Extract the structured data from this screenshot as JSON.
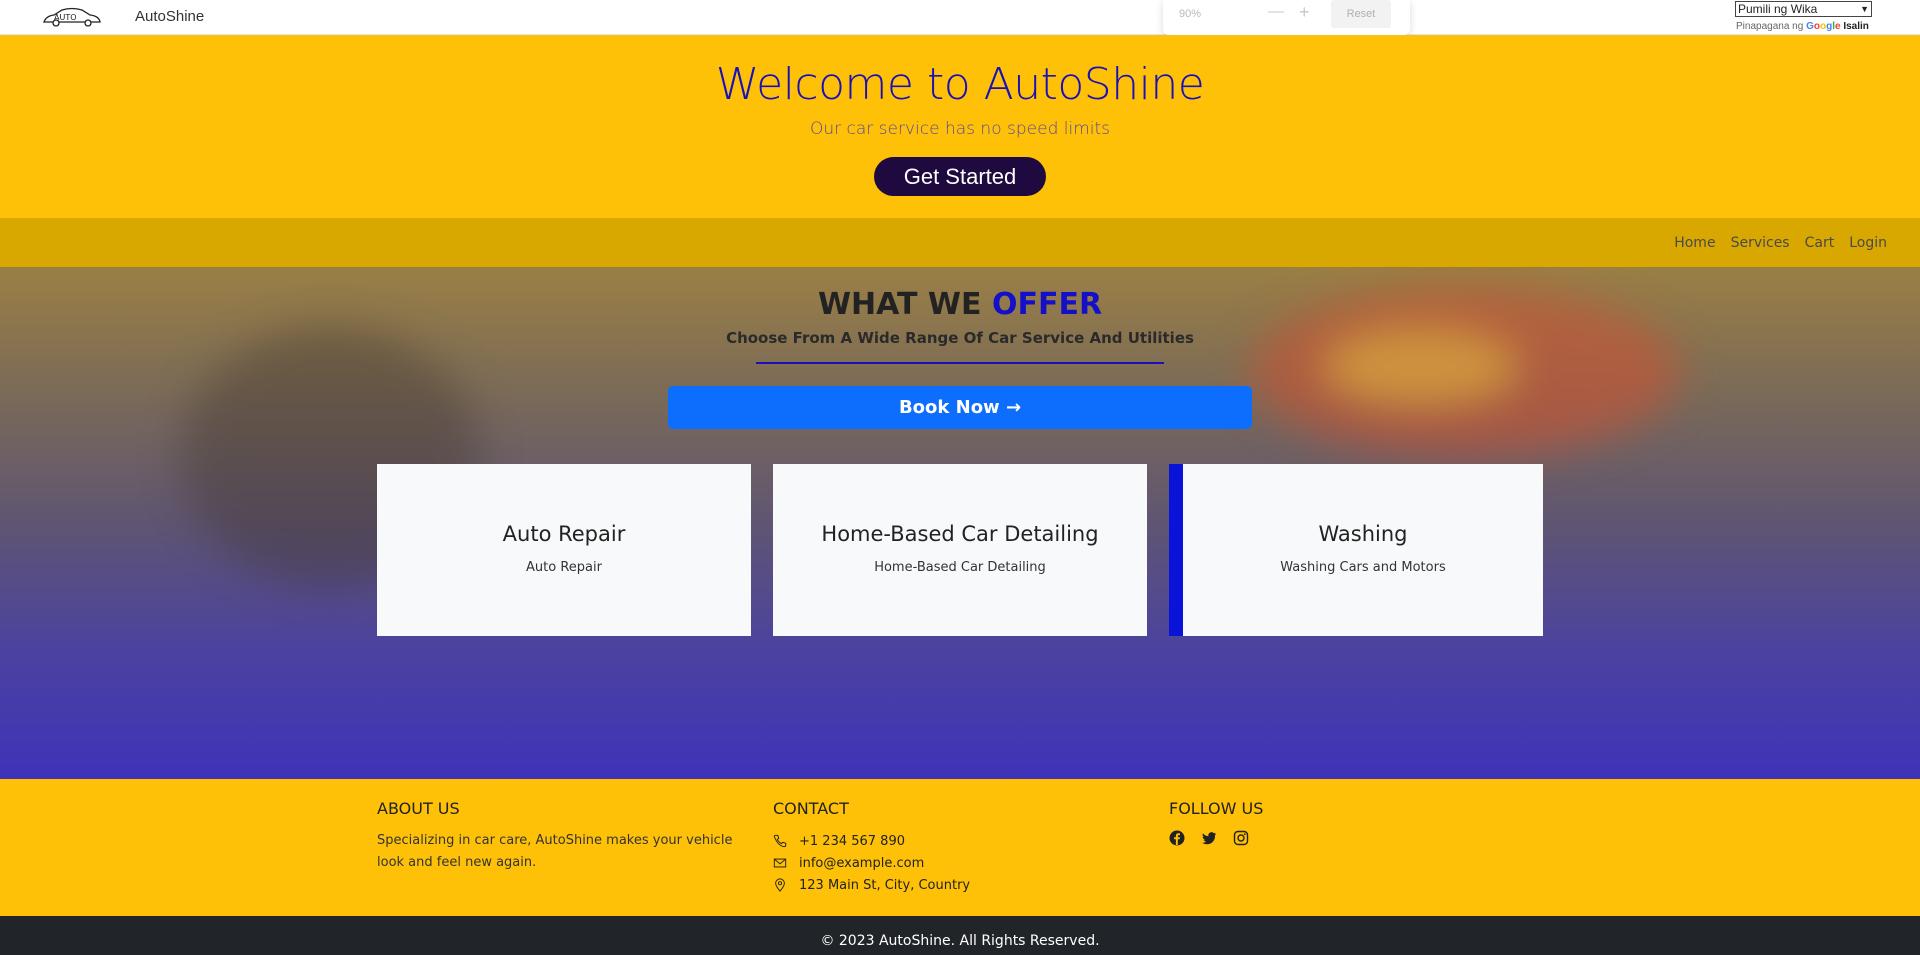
{
  "header": {
    "brand": "AutoShine",
    "logo_icon": "car-outline-logo"
  },
  "zoom_popup": {
    "percent": "90%",
    "minus": "—",
    "plus": "+",
    "reset_label": "Reset"
  },
  "translate": {
    "select_value": "Pumili ng Wika",
    "powered_by": "Pinapagana ng",
    "google": "Google",
    "translate_link": "Isalin"
  },
  "hero": {
    "title": "Welcome to AutoShine",
    "subtitle": "Our car service has no speed limits",
    "cta_label": "Get Started"
  },
  "nav": {
    "items": [
      "Home",
      "Services",
      "Cart",
      "Login"
    ]
  },
  "offer": {
    "title_prefix": "WHAT WE ",
    "title_highlight": "OFFER",
    "subtitle": "Choose From A Wide Range Of Car Service And Utilities",
    "book_label": "Book Now →"
  },
  "services": [
    {
      "title": "Auto Repair",
      "desc": "Auto Repair"
    },
    {
      "title": "Home-Based Car Detailing",
      "desc": "Home-Based Car Detailing"
    },
    {
      "title": "Washing",
      "desc": "Washing Cars and Motors"
    }
  ],
  "footer": {
    "about_heading": "ABOUT US",
    "about_text": "Specializing in car care, AutoShine makes your vehicle look and feel new again.",
    "contact_heading": "CONTACT",
    "phone": "+1 234 567 890",
    "email": "info@example.com",
    "address": "123 Main St, City, Country",
    "follow_heading": "FOLLOW US",
    "social": [
      "facebook-icon",
      "twitter-icon",
      "instagram-icon"
    ],
    "copyright": "© 2023 AutoShine. All Rights Reserved."
  },
  "colors": {
    "hero_bg": "#ffc107",
    "nav_bg": "#d8a800",
    "primary_blue": "#0d6efd",
    "accent_blue": "#1410c8",
    "footer_dark": "#212529"
  }
}
